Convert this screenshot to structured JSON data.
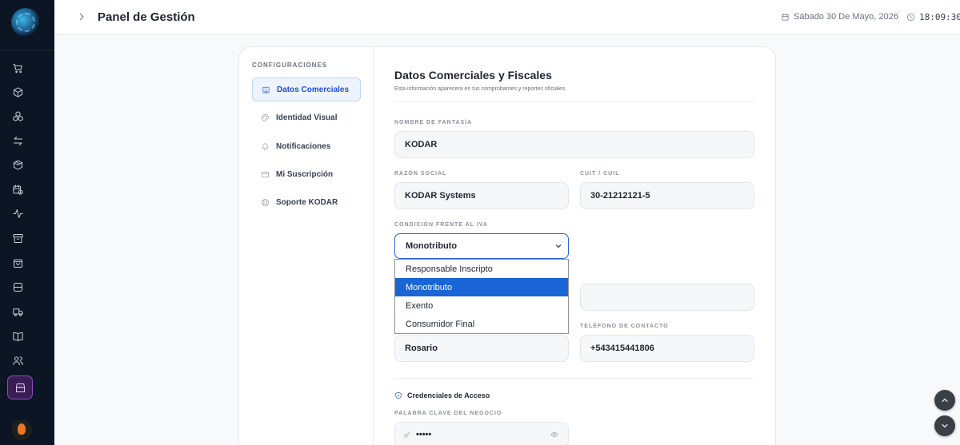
{
  "topbar": {
    "title": "Panel de Gestión",
    "date": "Sábado 30 De Mayo, 2026",
    "time": "18:09:30"
  },
  "sidebar": {
    "icons": [
      "cart-icon",
      "box-icon",
      "boxes-icon",
      "transfer-icon",
      "package-icon",
      "calendar-clock-icon",
      "activity-icon",
      "archive-icon",
      "shopping-bag-icon",
      "minus-square-icon",
      "truck-icon",
      "book-icon",
      "users-icon",
      "store-icon"
    ],
    "active": "store-icon"
  },
  "config_nav": {
    "heading": "CONFIGURACIONES",
    "items": [
      {
        "label": "Datos Comerciales",
        "icon": "building-icon",
        "active": true
      },
      {
        "label": "Identidad Visual",
        "icon": "palette-icon",
        "active": false
      },
      {
        "label": "Notificaciones",
        "icon": "bell-icon",
        "active": false
      },
      {
        "label": "Mi Suscripción",
        "icon": "credit-card-icon",
        "active": false
      },
      {
        "label": "Soporte KODAR",
        "icon": "lifebuoy-icon",
        "active": false
      }
    ]
  },
  "form": {
    "title": "Datos Comerciales y Fiscales",
    "subtitle": "Esta información aparecerá en tus comprobantes y reportes oficiales.",
    "nombre_fantasia": {
      "label": "NOMBRE DE FANTASÍA",
      "value": "KODAR"
    },
    "razon_social": {
      "label": "RAZÓN SOCIAL",
      "value": "KODAR Systems"
    },
    "cuit": {
      "label": "CUIT / CUIL",
      "value": "30-21212121-5"
    },
    "iva": {
      "label": "CONDICIÓN FRENTE AL IVA",
      "value": "Monotributo",
      "options": [
        "Responsable Inscripto",
        "Monotributo",
        "Exento",
        "Consumidor Final"
      ],
      "selected_index": 1
    },
    "ciudad": {
      "value": "Rosario"
    },
    "telefono": {
      "label": "TELÉFONO DE CONTACTO",
      "value": "+543415441806"
    },
    "credenciales": {
      "heading": "Credenciales de Acceso",
      "password_label": "PALABRA CLAVE DEL NEGOCIO",
      "password_value": "•••••"
    }
  },
  "colors": {
    "sidebar_bg": "#0b1524",
    "accent": "#2563eb",
    "active_nav_bg": "#3a1d52",
    "dropdown_selected": "#1a65d6"
  }
}
